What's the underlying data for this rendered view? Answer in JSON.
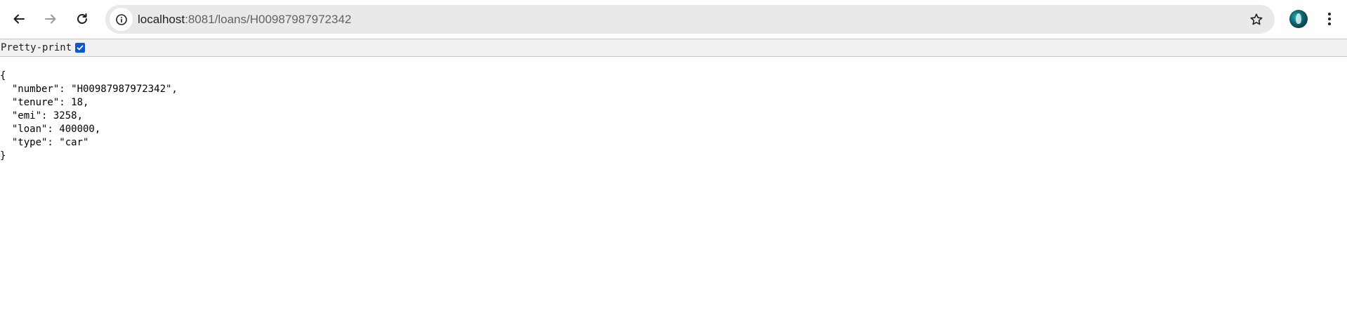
{
  "browser": {
    "url_host": "localhost",
    "url_rest": ":8081/loans/H00987987972342",
    "icons": {
      "back": "arrow-left-icon",
      "forward": "arrow-right-icon",
      "reload": "reload-icon",
      "site_info": "info-icon",
      "bookmark": "star-icon",
      "profile": "avatar",
      "menu": "kebab-menu-icon"
    }
  },
  "viewer": {
    "pretty_print_label": "Pretty-print",
    "pretty_print_checked": true
  },
  "json_text": "{\n  \"number\": \"H00987987972342\",\n  \"tenure\": 18,\n  \"emi\": 3258,\n  \"loan\": 400000,\n  \"type\": \"car\"\n}",
  "colors": {
    "checkbox": "#0b57d0",
    "omnibox": "#e9e9e9"
  }
}
